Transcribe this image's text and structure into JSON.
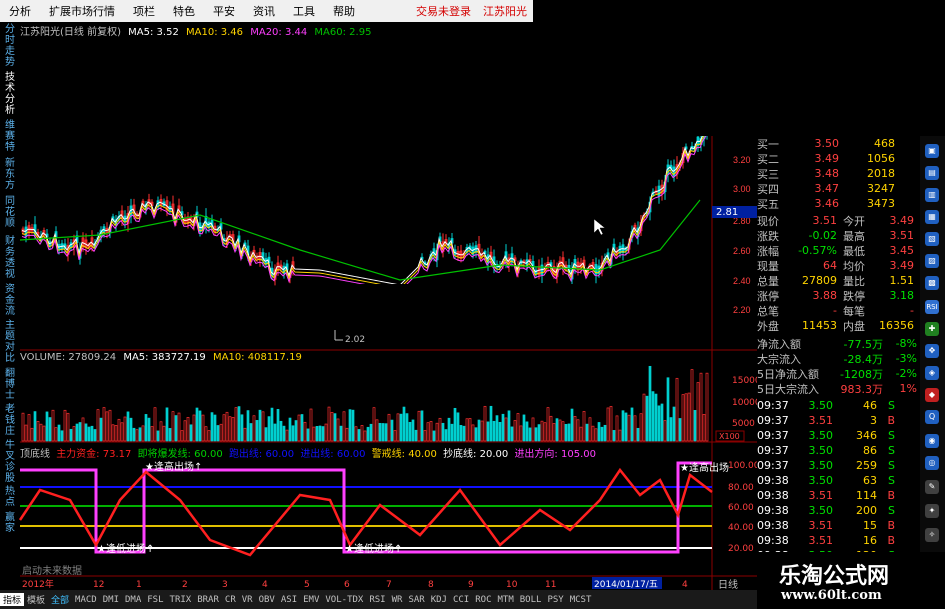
{
  "menu": {
    "items": [
      "分析",
      "扩展市场行情",
      "项栏",
      "特色",
      "平安",
      "资讯",
      "工具",
      "帮助"
    ],
    "trade_status": "交易未登录",
    "stock_title": "江苏阳光"
  },
  "left_tabs": [
    "分时走势",
    "技术分析",
    "维赛特",
    "新东方",
    "同花顺",
    "财务透视",
    "资金流",
    "主题对比",
    "翻博士",
    "老钱庄",
    "牛叉诊股",
    "热点",
    "赢家"
  ],
  "main_info": {
    "name": "江苏阳光(日线 前复权)",
    "ma5": "MA5: 3.52",
    "ma10": "MA10: 3.46",
    "ma20": "MA20: 3.44",
    "ma60": "MA60: 2.95"
  },
  "price_axis": [
    "3.20",
    "3.00",
    "2.80",
    "2.60",
    "2.40",
    "2.20"
  ],
  "price_marker": "2.81",
  "low_label": "2.02",
  "volume_info": {
    "volume": "VOLUME: 27809.24",
    "ma5": "MA5: 383727.19",
    "ma10": "MA10: 408117.19"
  },
  "volume_axis": [
    "15000",
    "10000",
    "5000"
  ],
  "volume_unit": "X100",
  "indicator_info": {
    "name": "顶底线",
    "main_fund": "主力资金: 73.17",
    "burst": "即将爆发线: 60.00",
    "hidden1": "跑出线: 60.00",
    "hidden2": "进出线: 60.00",
    "warn": "警戒线: 40.00",
    "bottom": "抄底线: 20.00",
    "direction": "进出方向: 105.00"
  },
  "indicator_axis": [
    "100.00",
    "80.00",
    "60.00",
    "40.00",
    "20.00"
  ],
  "indicator_labels": {
    "exit1": "★逢高出场↑",
    "exit2": "★逢高出场",
    "enter1": "★逢低进场↑",
    "enter2": "★逢低进场↑"
  },
  "future_data": "启动未来数据",
  "date_axis": [
    "2012年",
    "12",
    "1",
    "2",
    "3",
    "4",
    "5",
    "6",
    "7",
    "8",
    "9",
    "10",
    "11",
    "2014/01/17/五",
    "4"
  ],
  "period": "日线",
  "bid_rows": [
    {
      "label": "买一",
      "price": "3.50",
      "vol": "468"
    },
    {
      "label": "买二",
      "price": "3.49",
      "vol": "1056"
    },
    {
      "label": "买三",
      "price": "3.48",
      "vol": "2018"
    },
    {
      "label": "买四",
      "price": "3.47",
      "vol": "3247"
    },
    {
      "label": "买五",
      "price": "3.46",
      "vol": "3473"
    }
  ],
  "quote_rows": [
    {
      "l1": "现价",
      "v1": "3.51",
      "l2": "今开",
      "v2": "3.49"
    },
    {
      "l1": "涨跌",
      "v1": "-0.02",
      "l2": "最高",
      "v2": "3.51"
    },
    {
      "l1": "涨幅",
      "v1": "-0.57%",
      "l2": "最低",
      "v2": "3.45"
    },
    {
      "l1": "现量",
      "v1": "64",
      "l2": "均价",
      "v2": "3.49"
    },
    {
      "l1": "总量",
      "v1": "27809",
      "l2": "量比",
      "v2": "1.51"
    },
    {
      "l1": "涨停",
      "v1": "3.88",
      "l2": "跌停",
      "v2": "3.18"
    },
    {
      "l1": "总笔",
      "v1": "-",
      "l2": "每笔",
      "v2": "-"
    },
    {
      "l1": "外盘",
      "v1": "11453",
      "l2": "内盘",
      "v2": "16356"
    }
  ],
  "flow_rows": [
    {
      "label": "净流入额",
      "value": "-77.5万",
      "pct": "-8%"
    },
    {
      "label": "大宗流入",
      "value": "-28.4万",
      "pct": "-3%"
    },
    {
      "label": "5日净流入额",
      "value": "-1208万",
      "pct": "-2%"
    },
    {
      "label": "5日大宗流入",
      "value": "983.3万",
      "pct": "1%"
    }
  ],
  "tick_rows": [
    {
      "time": "09:37",
      "price": "3.50",
      "vol": "46",
      "dir": "S"
    },
    {
      "time": "09:37",
      "price": "3.51",
      "vol": "3",
      "dir": "B"
    },
    {
      "time": "09:37",
      "price": "3.50",
      "vol": "346",
      "dir": "S"
    },
    {
      "time": "09:37",
      "price": "3.50",
      "vol": "86",
      "dir": "S"
    },
    {
      "time": "09:37",
      "price": "3.50",
      "vol": "259",
      "dir": "S"
    },
    {
      "time": "09:38",
      "price": "3.50",
      "vol": "63",
      "dir": "S"
    },
    {
      "time": "09:38",
      "price": "3.51",
      "vol": "114",
      "dir": "B"
    },
    {
      "time": "09:38",
      "price": "3.50",
      "vol": "200",
      "dir": "S"
    },
    {
      "time": "09:38",
      "price": "3.51",
      "vol": "15",
      "dir": "B"
    },
    {
      "time": "09:38",
      "price": "3.51",
      "vol": "16",
      "dir": "B"
    },
    {
      "time": "09:38",
      "price": "3.50",
      "vol": "120",
      "dir": "S"
    }
  ],
  "right_icons": [
    "RSI",
    "Q"
  ],
  "bottom_tabs": [
    "指标",
    "模板",
    "全部",
    "MACD",
    "DMI",
    "DMA",
    "FSL",
    "TRIX",
    "BRAR",
    "CR",
    "VR",
    "OBV",
    "ASI",
    "EMV",
    "VOL-TDX",
    "RSI",
    "WR",
    "SAR",
    "KDJ",
    "CCI",
    "ROC",
    "MTM",
    "BOLL",
    "PSY",
    "MCST"
  ],
  "logo": {
    "title": "乐淘公式网",
    "url": "www.60lt.com"
  },
  "colors": {
    "up": "#ff3030",
    "down": "#00d0d0",
    "ma5": "#ffffff",
    "ma10": "#ffd400",
    "ma20": "#ff40ff",
    "ma60": "#00c000",
    "magenta": "#ff40ff",
    "gold": "#ffd400"
  }
}
